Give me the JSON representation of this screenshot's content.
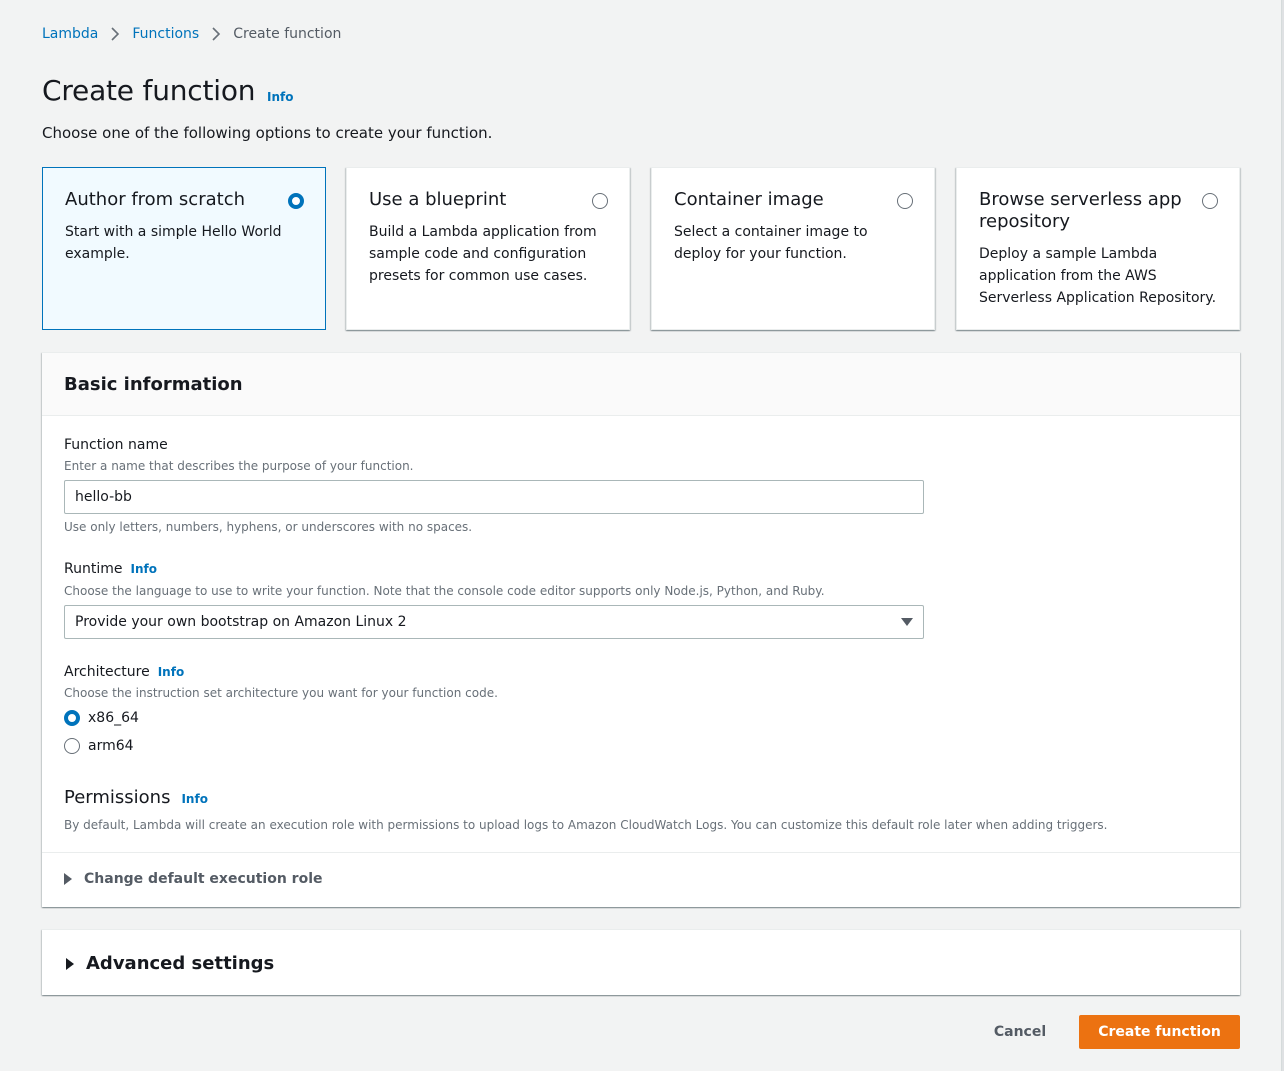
{
  "breadcrumb": {
    "items": [
      "Lambda",
      "Functions"
    ],
    "current": "Create function"
  },
  "header": {
    "title": "Create function",
    "info": "Info",
    "description": "Choose one of the following options to create your function."
  },
  "options": [
    {
      "title": "Author from scratch",
      "description": "Start with a simple Hello World example.",
      "selected": true
    },
    {
      "title": "Use a blueprint",
      "description": "Build a Lambda application from sample code and configuration presets for common use cases.",
      "selected": false
    },
    {
      "title": "Container image",
      "description": "Select a container image to deploy for your function.",
      "selected": false
    },
    {
      "title": "Browse serverless app repository",
      "description": "Deploy a sample Lambda application from the AWS Serverless Application Repository.",
      "selected": false
    }
  ],
  "basic_info": {
    "title": "Basic information",
    "function_name": {
      "label": "Function name",
      "description": "Enter a name that describes the purpose of your function.",
      "value": "hello-bb",
      "constraint": "Use only letters, numbers, hyphens, or underscores with no spaces."
    },
    "runtime": {
      "label": "Runtime",
      "info": "Info",
      "description": "Choose the language to use to write your function. Note that the console code editor supports only Node.js, Python, and Ruby.",
      "selected": "Provide your own bootstrap on Amazon Linux 2"
    },
    "architecture": {
      "label": "Architecture",
      "info": "Info",
      "description": "Choose the instruction set architecture you want for your function code.",
      "options": [
        {
          "label": "x86_64",
          "selected": true
        },
        {
          "label": "arm64",
          "selected": false
        }
      ]
    },
    "permissions": {
      "title": "Permissions",
      "info": "Info",
      "description": "By default, Lambda will create an execution role with permissions to upload logs to Amazon CloudWatch Logs. You can customize this default role later when adding triggers.",
      "expander": "Change default execution role"
    }
  },
  "advanced": {
    "title": "Advanced settings"
  },
  "footer": {
    "cancel": "Cancel",
    "submit": "Create function"
  },
  "colors": {
    "link": "#0073bb",
    "primary_button": "#ec7211",
    "selected_tile_bg": "#f1faff"
  }
}
